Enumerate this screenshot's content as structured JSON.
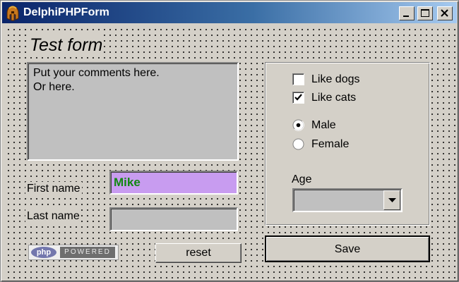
{
  "window": {
    "title": "DelphiPHPForm",
    "icon": "spartan-helmet-icon",
    "caption_buttons": [
      "minimize-icon",
      "maximize-icon",
      "close-icon"
    ]
  },
  "form": {
    "heading": "Test form",
    "comments": {
      "lines": [
        "Put your comments here.",
        "Or here."
      ]
    },
    "first_name": {
      "label": "First name",
      "value": "Mike",
      "bg_color": "#c89cf0",
      "text_color": "#118811"
    },
    "last_name": {
      "label": "Last name",
      "value": ""
    },
    "php_badge": {
      "logo": "php",
      "text": "POWERED"
    },
    "reset_label": "reset",
    "save_label": "Save",
    "options": {
      "like_dogs": {
        "label": "Like dogs",
        "checked": false
      },
      "like_cats": {
        "label": "Like cats",
        "checked": true
      },
      "gender": {
        "options": [
          "Male",
          "Female"
        ],
        "selected": "Male"
      },
      "age": {
        "label": "Age",
        "value": ""
      }
    }
  }
}
